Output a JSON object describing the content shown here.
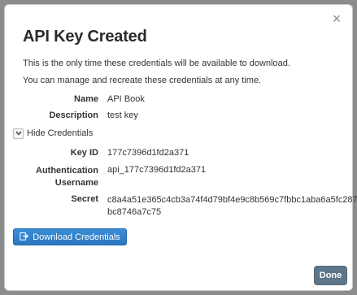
{
  "modal": {
    "title": "API Key Created",
    "close_glyph": "×",
    "intro_1": "This is the only time these credentials will be available to download.",
    "intro_2": "You can manage and recreate these credentials at any time."
  },
  "details": {
    "name_label": "Name",
    "name_value": "API Book",
    "description_label": "Description",
    "description_value": "test key"
  },
  "toggle": {
    "label": "Hide Credentials",
    "icon": "chevron-down-icon"
  },
  "credentials": {
    "key_id_label": "Key ID",
    "key_id_value": "177c7396d1fd2a371",
    "auth_label_line1": "Authentication",
    "auth_label_line2": "Username",
    "auth_value": "api_177c7396d1fd2a371",
    "secret_label": "Secret",
    "secret_line1": "c8a4a51e365c4cb3a74f4d79bf4e9c8b569c7fbbc1aba6a5fc287",
    "secret_line2": "bc8746a7c75"
  },
  "actions": {
    "download_label": "Download Credentials",
    "download_icon": "export-icon",
    "done_label": "Done"
  },
  "colors": {
    "primary": "#2f80cc",
    "done": "#5e7689",
    "overlay": "#8c8c8c"
  }
}
